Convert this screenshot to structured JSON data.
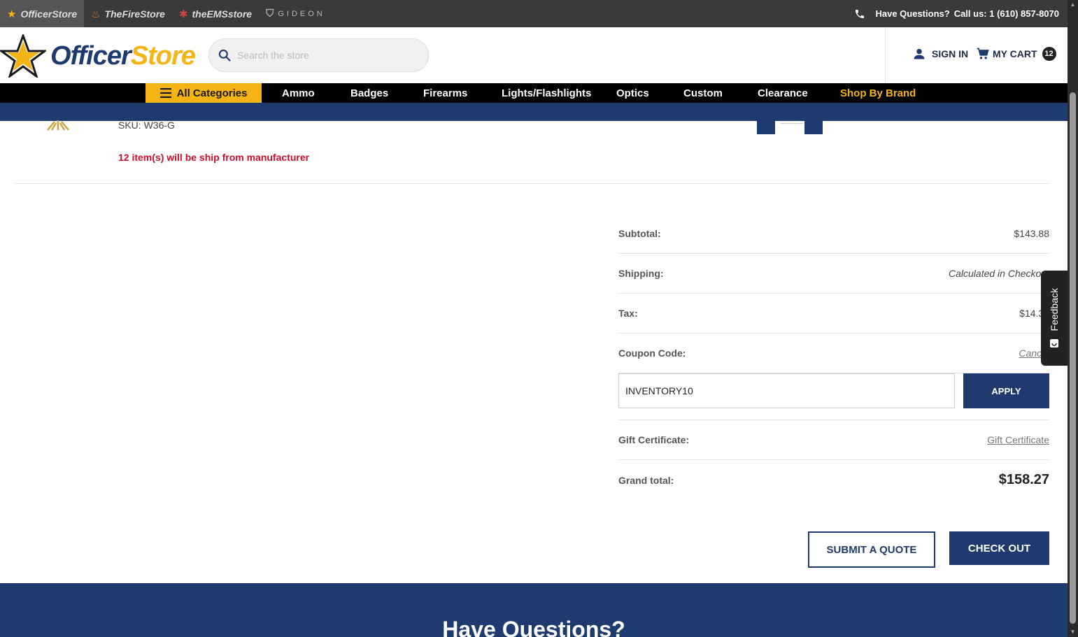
{
  "brands": [
    {
      "label": "OfficerStore",
      "icon": "star-icon",
      "active": true
    },
    {
      "label": "TheFireStore",
      "icon": "flame-icon",
      "active": false
    },
    {
      "label": "theEMSstore",
      "icon": "star-of-life-icon",
      "active": false
    },
    {
      "label": "GIDEON",
      "icon": "gideon-shield-icon",
      "active": false
    }
  ],
  "topbar": {
    "questions_label": "Have Questions?",
    "call_label": "Call us: 1 (610) 857-8070"
  },
  "header": {
    "logo_part1": "Officer",
    "logo_part2": "Store",
    "search_placeholder": "Search the store",
    "signin_label": "SIGN IN",
    "cart_label": "MY CART",
    "cart_count": "12"
  },
  "nav": {
    "all_categories": "All Categories",
    "items": [
      "Ammo",
      "Badges",
      "Firearms",
      "Lights/Flashlights",
      "Optics",
      "Custom",
      "Clearance",
      "Shop By Brand"
    ]
  },
  "cart_item": {
    "sku": "SKU: W36-G",
    "ship_note": "12 item(s) will be ship from manufacturer"
  },
  "totals": {
    "subtotal_label": "Subtotal:",
    "subtotal_value": "$143.88",
    "shipping_label": "Shipping:",
    "shipping_value": "Calculated in Checkout",
    "tax_label": "Tax:",
    "tax_value": "$14.39",
    "coupon_label": "Coupon Code:",
    "coupon_cancel": "Cancel",
    "coupon_value": "INVENTORY10",
    "apply_label": "APPLY",
    "gift_label": "Gift Certificate:",
    "gift_link": "Gift Certificate",
    "grand_label": "Grand total:",
    "grand_value": "$158.27"
  },
  "actions": {
    "quote_label": "SUBMIT A QUOTE",
    "checkout_label": "CHECK OUT"
  },
  "footer": {
    "title": "Have Questions?"
  },
  "feedback": {
    "label": "Feedback"
  },
  "colors": {
    "navy": "#1e3a6e",
    "gold": "#f4b416",
    "alert_red": "#c8102e"
  }
}
